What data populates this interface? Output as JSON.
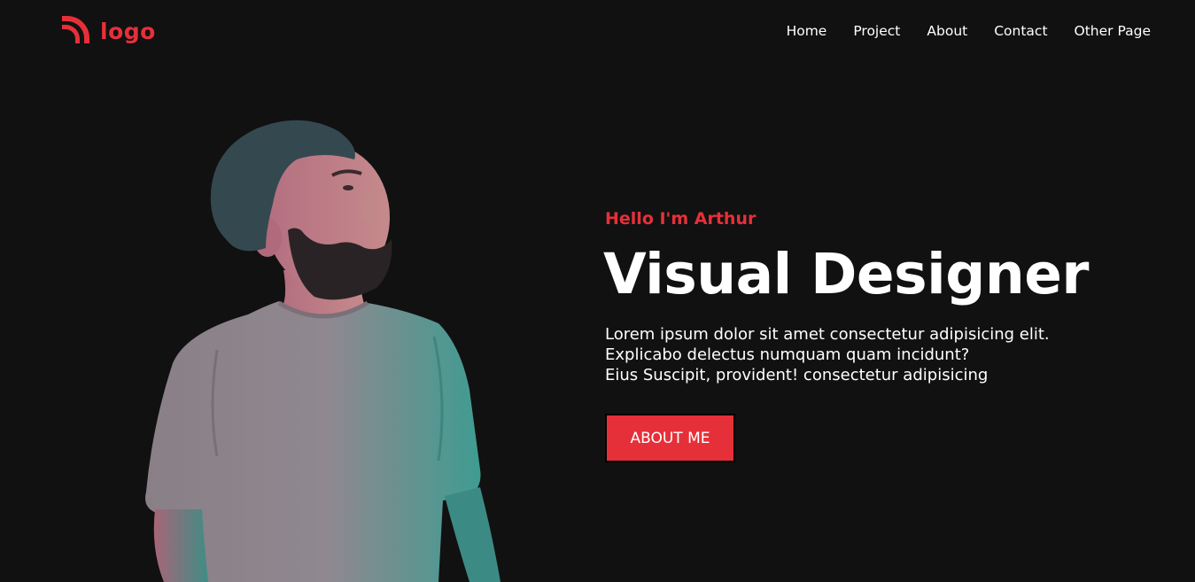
{
  "header": {
    "logo_text": "logo",
    "nav": [
      {
        "label": "Home"
      },
      {
        "label": "Project"
      },
      {
        "label": "About"
      },
      {
        "label": "Contact"
      },
      {
        "label": "Other Page"
      }
    ]
  },
  "hero": {
    "greeting": "Hello I'm Arthur",
    "title": "Visual Designer",
    "description_lines": [
      "Lorem ipsum dolor sit amet consectetur adipisicing elit.",
      "Explicabo delectus numquam quam incidunt?",
      "Eius Suscipit, provident! consectetur adipisicing"
    ],
    "button_label": "ABOUT ME"
  },
  "colors": {
    "background": "#111111",
    "accent": "#e63039",
    "text": "#ffffff"
  },
  "icons": {
    "logo": "signal-arcs-icon"
  }
}
